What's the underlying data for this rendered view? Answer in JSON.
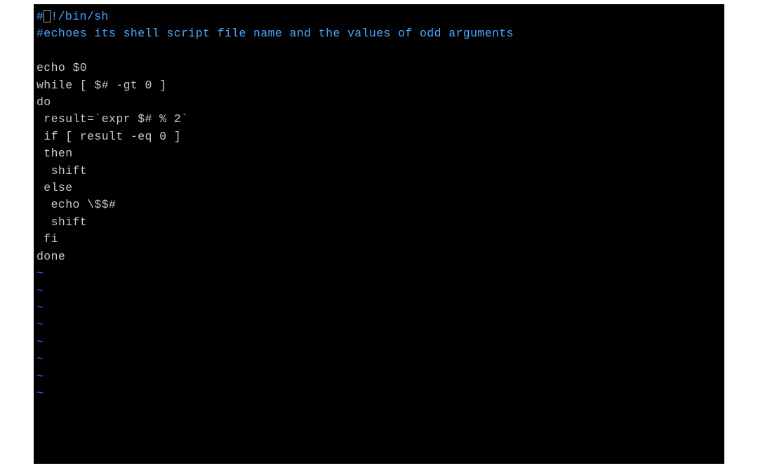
{
  "editor": {
    "lines": [
      {
        "type": "comment_with_cursor",
        "prefix": "#",
        "rest": "!/bin/sh"
      },
      {
        "type": "comment",
        "text": "#echoes its shell script file name and the values of odd arguments"
      },
      {
        "type": "blank",
        "text": ""
      },
      {
        "type": "code",
        "text": "echo $0"
      },
      {
        "type": "code",
        "text": "while [ $# -gt 0 ]"
      },
      {
        "type": "code",
        "text": "do"
      },
      {
        "type": "code",
        "text": " result=`expr $# % 2`"
      },
      {
        "type": "code",
        "text": " if [ result -eq 0 ]"
      },
      {
        "type": "code",
        "text": " then"
      },
      {
        "type": "code",
        "text": "  shift"
      },
      {
        "type": "code",
        "text": " else"
      },
      {
        "type": "code",
        "text": "  echo \\$$#"
      },
      {
        "type": "code",
        "text": "  shift"
      },
      {
        "type": "code",
        "text": " fi"
      },
      {
        "type": "code",
        "text": "done"
      },
      {
        "type": "tilde",
        "text": "~"
      },
      {
        "type": "tilde",
        "text": "~"
      },
      {
        "type": "tilde",
        "text": "~"
      },
      {
        "type": "tilde",
        "text": "~"
      },
      {
        "type": "tilde",
        "text": "~"
      },
      {
        "type": "tilde",
        "text": "~"
      },
      {
        "type": "tilde",
        "text": "~"
      },
      {
        "type": "tilde",
        "text": "~"
      }
    ]
  }
}
